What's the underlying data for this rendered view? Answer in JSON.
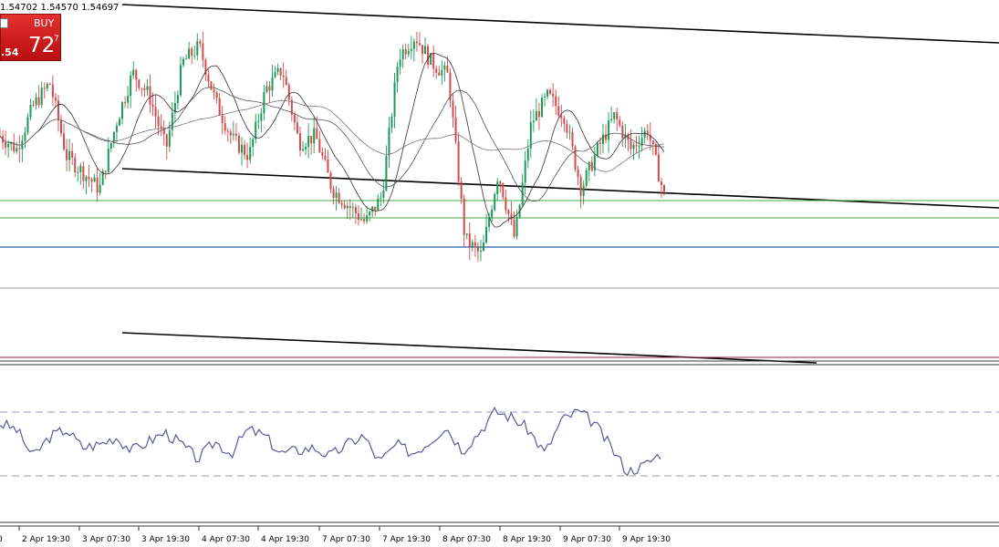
{
  "header": {
    "ohlc_text": "1.54702 1.54570 1.54697"
  },
  "trade_panel": {
    "buy_label": "BUY",
    "price_prefix": ".54",
    "price_big": "72",
    "price_sup": "7",
    "buy_color": "#d41f1f"
  },
  "chart_data": {
    "type": "candlestick",
    "title": "",
    "x_tick_labels": [
      "2 Apr 19:30",
      "3 Apr 07:30",
      "3 Apr 19:30",
      "4 Apr 07:30",
      "4 Apr 19:30",
      "7 Apr 07:30",
      "7 Apr 19:30",
      "8 Apr 07:30",
      "8 Apr 19:30",
      "9 Apr 07:30",
      "9 Apr 19:30"
    ],
    "x_tick_left_fragment": "0",
    "price_close_path": [
      0.66,
      0.62,
      0.75,
      0.82,
      0.6,
      0.55,
      0.5,
      0.7,
      0.85,
      0.78,
      0.62,
      0.88,
      0.93,
      0.76,
      0.65,
      0.6,
      0.8,
      0.86,
      0.64,
      0.66,
      0.5,
      0.45,
      0.4,
      0.48,
      0.9,
      0.96,
      0.88,
      0.84,
      0.35,
      0.3,
      0.55,
      0.35,
      0.7,
      0.78,
      0.72,
      0.5,
      0.62,
      0.72,
      0.62,
      0.68,
      0.48
    ],
    "indicator": {
      "name": "",
      "levels": [
        70,
        30
      ],
      "values": [
        64,
        60,
        42,
        55,
        60,
        48,
        50,
        55,
        46,
        52,
        58,
        50,
        40,
        52,
        44,
        60,
        56,
        44,
        46,
        48,
        42,
        50,
        56,
        38,
        50,
        44,
        52,
        62,
        46,
        58,
        72,
        68,
        60,
        44,
        66,
        72,
        64,
        48,
        32,
        36,
        44
      ]
    },
    "grid": false,
    "colors": {
      "bull_candle": "#1a9a55",
      "bear_candle": "#d44a4a",
      "trend_lines": "#000000",
      "support_resistance": "#3fa83f",
      "price_level": "#1f5fa8",
      "current_level": "#888888",
      "bottom_level": "#a02040",
      "indicator_line": "#5a5a9a",
      "indicator_levels": "#8a8aaa"
    }
  }
}
